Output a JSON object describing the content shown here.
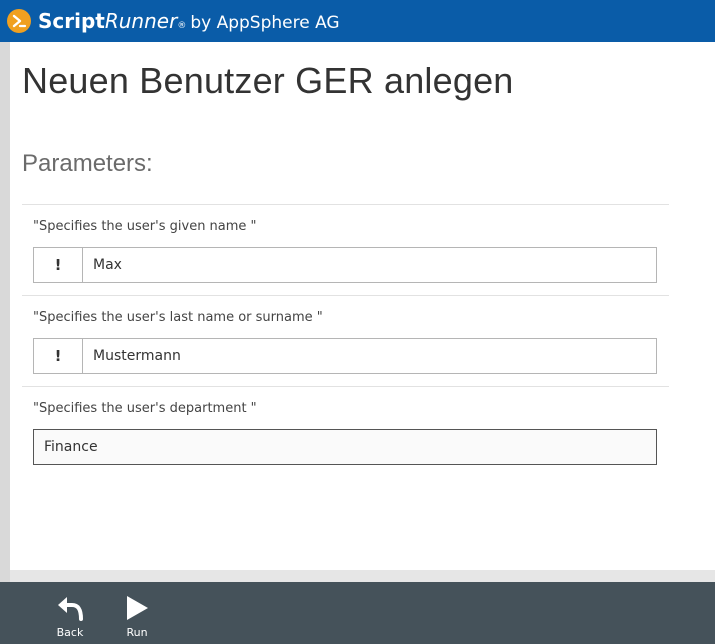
{
  "header": {
    "brand_script": "Script",
    "brand_runner": "Runner",
    "brand_reg": "®",
    "brand_by": "by AppSphere AG",
    "accent": "#0a5ca8",
    "logo_color": "#f0a020",
    "logo_icon": "chevron-logo-icon"
  },
  "page": {
    "title": "Neuen Benutzer GER anlegen",
    "parameters_heading": "Parameters:"
  },
  "parameters": [
    {
      "label": "\"Specifies the user's given name \"",
      "value": "Max",
      "required_marker": "!",
      "required": true
    },
    {
      "label": "\"Specifies the user's last name or surname \"",
      "value": "Mustermann",
      "required_marker": "!",
      "required": true
    },
    {
      "label": "\"Specifies the user's department \"",
      "value": "Finance",
      "required": false
    }
  ],
  "footer": {
    "background": "#45525a",
    "back_label": "Back",
    "back_icon": "back-arrow-icon",
    "run_label": "Run",
    "run_icon": "play-icon"
  }
}
